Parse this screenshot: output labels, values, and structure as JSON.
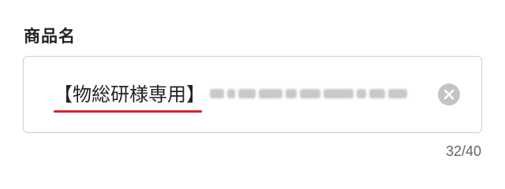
{
  "form": {
    "product_name_label": "商品名",
    "product_name_value_visible": "【物総研様専用】",
    "char_count": "32/40"
  },
  "icons": {
    "clear": "close-circle-icon"
  },
  "colors": {
    "underline_accent": "#d9232d",
    "input_border": "#cfcfcf",
    "clear_icon_bg": "#c4c4c4",
    "counter_text": "#666666"
  }
}
